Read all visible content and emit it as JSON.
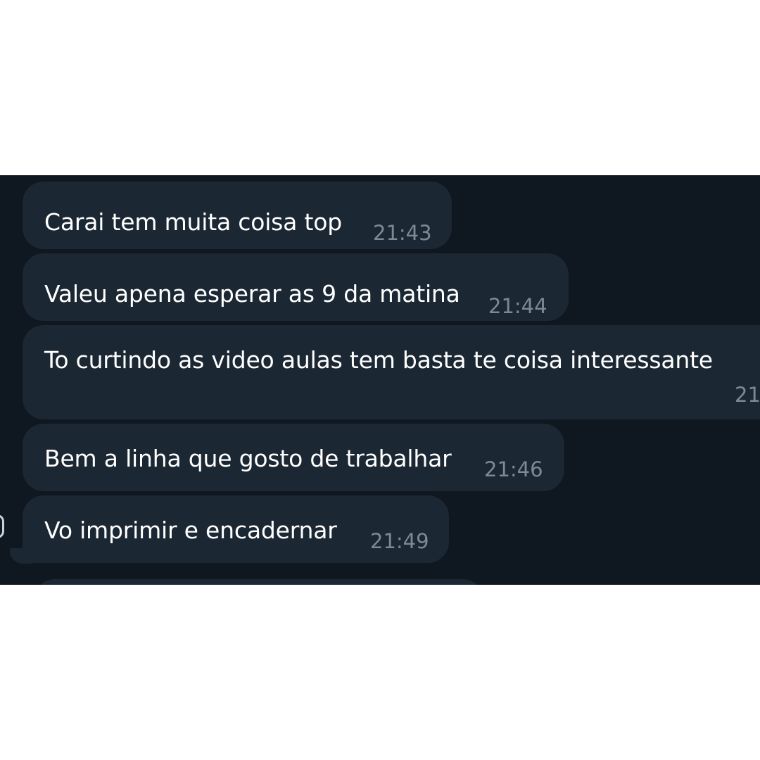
{
  "messages": [
    {
      "text": "Carai tem muita coisa top",
      "time": "21:43"
    },
    {
      "text": "Valeu apena esperar as 9 da matina",
      "time": "21:44"
    },
    {
      "text": "To curtindo as video aulas tem basta te coisa interessante",
      "time": "21"
    },
    {
      "text": "Bem a linha que gosto de trabalhar",
      "time": "21:46"
    },
    {
      "text": "Vo imprimir e encadernar",
      "time": "21:49"
    }
  ],
  "colors": {
    "chat_background": "#0f1720",
    "bubble_background": "#1b2733",
    "message_text": "#ffffff",
    "timestamp_text": "#7d8a96",
    "page_background": "#ffffff"
  },
  "icons": {
    "partial_avatar": "avatar-icon"
  }
}
